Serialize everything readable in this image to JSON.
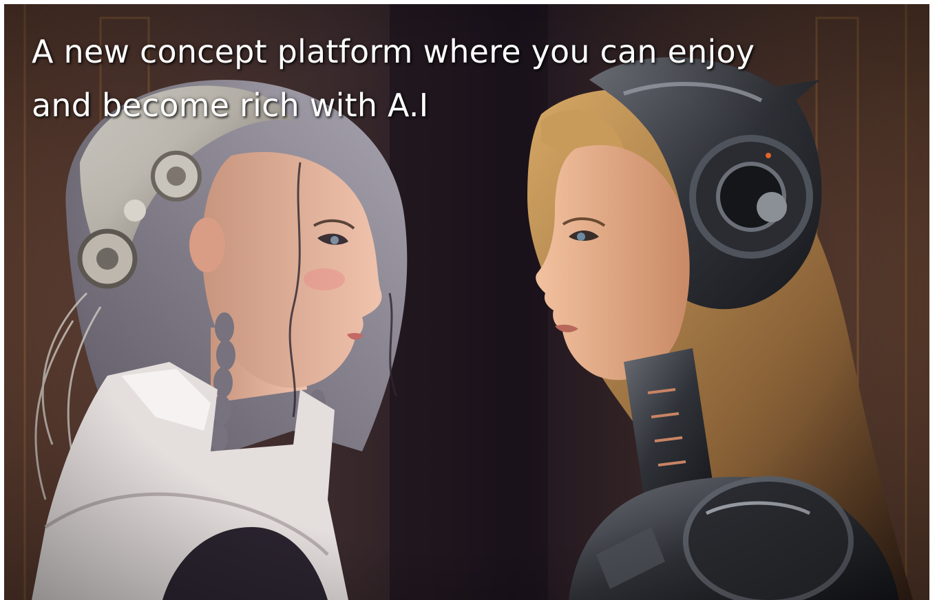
{
  "headline": {
    "line1": "A new concept platform where you can enjoy",
    "line2": "and become rich with A.I"
  },
  "colors": {
    "headline_text": "#ffffff",
    "background_dark": "#2a1c1e",
    "wall_brown": "#5a3a2a",
    "human_hair": "#8d8a94",
    "robot_hair": "#b48a4e",
    "robot_armor": "#3c3f46",
    "skin": "#e8b79d",
    "collar": "#e8e2e0"
  }
}
